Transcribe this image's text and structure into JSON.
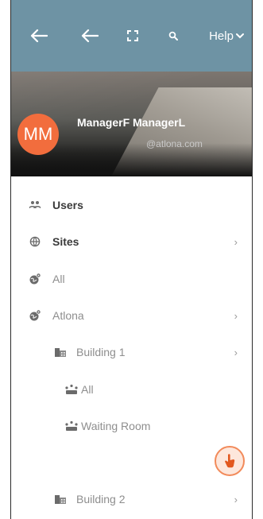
{
  "header": {
    "back_icon_primary": "arrow-left-icon",
    "back_icon_secondary": "arrow-left-icon",
    "fullscreen_icon": "fullscreen-icon",
    "search_icon": "search-icon",
    "help_label": "Help",
    "help_caret_icon": "chevron-down-icon",
    "bar_color": "#6e93a4"
  },
  "profile": {
    "initials": "MM",
    "name": "ManagerF ManagerL",
    "email": "@atlona.com",
    "avatar_color": "#f26d3d"
  },
  "menu": {
    "users": {
      "label": "Users",
      "icon": "users-icon"
    },
    "sites": {
      "label": "Sites",
      "icon": "globe-icon"
    },
    "all_sites": {
      "label": "All",
      "icon": "globe-pin-icon"
    },
    "atlona": {
      "label": "Atlona",
      "icon": "globe-pin-icon"
    },
    "building1": {
      "label": "Building 1",
      "icon": "building-icon"
    },
    "b1_all": {
      "label": "All",
      "icon": "room-icon"
    },
    "waiting_room": {
      "label": "Waiting Room",
      "icon": "room-icon"
    },
    "building2": {
      "label": "Building 2",
      "icon": "building-icon"
    }
  },
  "touch_button": {
    "icon": "touch-hand-icon",
    "accent": "#f28a5a"
  }
}
